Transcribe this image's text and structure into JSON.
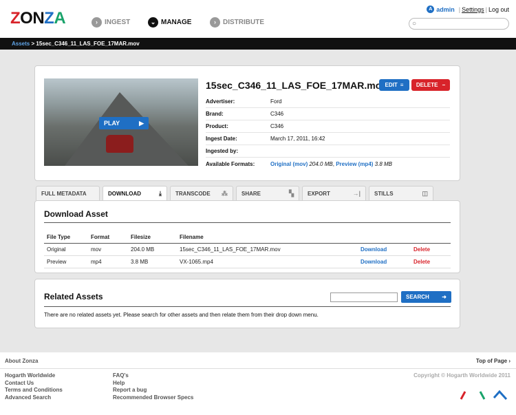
{
  "header": {
    "logo": "ZONZA",
    "nav": [
      {
        "label": "INGEST",
        "active": false
      },
      {
        "label": "MANAGE",
        "active": true
      },
      {
        "label": "DISTRIBUTE",
        "active": false
      }
    ],
    "user_initial": "A",
    "user": "admin",
    "settings": "Settings",
    "logout": "Log out",
    "search_placeholder": ""
  },
  "breadcrumb": {
    "root": "Assets",
    "separator": ">",
    "current": "15sec_C346_11_LAS_FOE_17MAR.mov"
  },
  "asset": {
    "title": "15sec_C346_11_LAS_FOE_17MAR.mov",
    "play_label": "PLAY",
    "edit_label": "EDIT",
    "delete_label": "DELETE",
    "metadata": [
      {
        "key": "Advertiser:",
        "value": "Ford"
      },
      {
        "key": "Brand:",
        "value": "C346"
      },
      {
        "key": "Product:",
        "value": "C346"
      },
      {
        "key": "Ingest Date:",
        "value": "March 17, 2011, 16:42"
      },
      {
        "key": "Ingested by:",
        "value": ""
      }
    ],
    "formats_label": "Available Formats:",
    "formats": [
      {
        "name": "Original (mov)",
        "size": "204.0 MB",
        "sep": ","
      },
      {
        "name": "Preview (mp4)",
        "size": "3.8 MB",
        "sep": ""
      }
    ]
  },
  "tabs": [
    {
      "label": "FULL METADATA",
      "icon": "list-icon",
      "active": false
    },
    {
      "label": "DOWNLOAD",
      "icon": "download-icon",
      "active": true
    },
    {
      "label": "TRANSCODE",
      "icon": "transcode-icon",
      "active": false
    },
    {
      "label": "SHARE",
      "icon": "share-icon",
      "active": false
    },
    {
      "label": "EXPORT",
      "icon": "export-icon",
      "active": false
    },
    {
      "label": "STILLS",
      "icon": "camera-icon",
      "active": false
    }
  ],
  "download": {
    "title": "Download Asset",
    "headers": {
      "type": "File Type",
      "format": "Format",
      "size": "Filesize",
      "name": "Filename"
    },
    "rows": [
      {
        "type": "Original",
        "format": "mov",
        "size": "204.0 MB",
        "name": "15sec_C346_11_LAS_FOE_17MAR.mov",
        "download": "Download",
        "delete": "Delete"
      },
      {
        "type": "Preview",
        "format": "mp4",
        "size": "3.8 MB",
        "name": "VX-1065.mp4",
        "download": "Download",
        "delete": "Delete"
      }
    ]
  },
  "related": {
    "title": "Related Assets",
    "search_label": "SEARCH",
    "input_value": "",
    "empty_text": "There are no related assets yet. Please search for other assets and then relate them from their drop down menu."
  },
  "footer": {
    "about": "About Zonza",
    "top_of_page": "Top of Page",
    "col1": [
      "Hogarth Worldwide",
      "Contact Us",
      "Terms and Conditions",
      "Advanced Search"
    ],
    "col2": [
      "FAQ's",
      "Help",
      "Report a bug",
      "Recommended Browser Specs"
    ],
    "copyright": "Copyright © Hogarth Worldwide 2011"
  },
  "colors": {
    "blue": "#1f6fc4",
    "red": "#d8232a",
    "green": "#1aa36b"
  }
}
